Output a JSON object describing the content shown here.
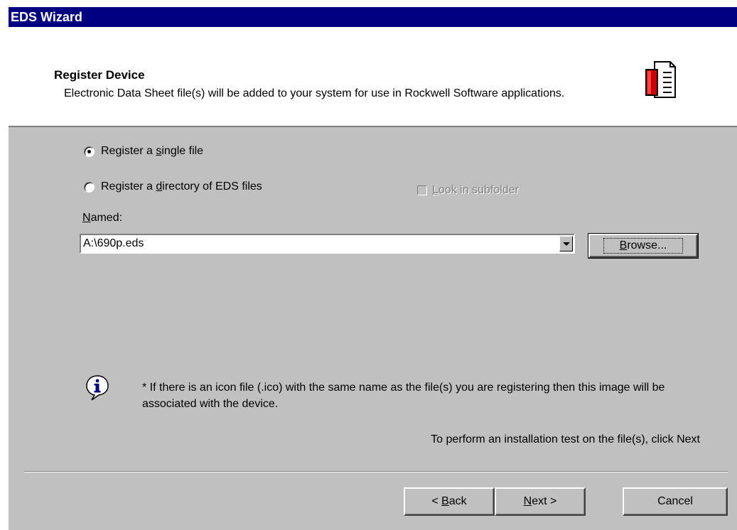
{
  "window": {
    "title": "EDS Wizard"
  },
  "header": {
    "title": "Register Device",
    "description": "Electronic Data Sheet file(s) will be added to your system for use in Rockwell Software applications.",
    "icon": "document-icon"
  },
  "options": {
    "single_pre": "Register a ",
    "single_key": "s",
    "single_post": "ingle file",
    "single_checked": true,
    "dir_pre": "Register a ",
    "dir_key": "d",
    "dir_post": "irectory of EDS files",
    "dir_checked": false,
    "subfolder_key": "L",
    "subfolder_post": "ook in subfolder",
    "subfolder_checked": false,
    "subfolder_enabled": false
  },
  "named": {
    "label_key": "N",
    "label_post": "amed:",
    "value": "A:\\690p.eds"
  },
  "browse": {
    "key": "B",
    "post": "rowse..."
  },
  "info": {
    "icon": "info-icon",
    "text": "* If there is an icon file (.ico) with the same name as the file(s) you are registering then this image will be associated with the device."
  },
  "hint": "To perform an installation test on the file(s), click Next",
  "buttons": {
    "back_prefix": "< ",
    "back_key": "B",
    "back_post": "ack",
    "next_key": "N",
    "next_post": "ext >",
    "cancel": "Cancel"
  }
}
